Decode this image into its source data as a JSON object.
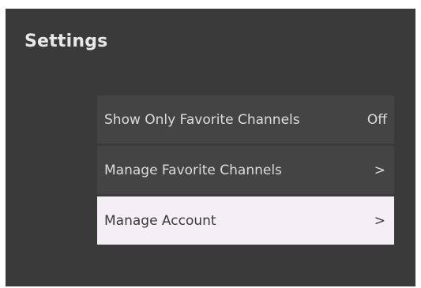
{
  "header": {
    "title": "Settings"
  },
  "menu": {
    "items": [
      {
        "label": "Show Only Favorite Channels",
        "value": "Off"
      },
      {
        "label": "Manage Favorite Channels",
        "chevron": ">"
      },
      {
        "label": "Manage Account",
        "chevron": ">",
        "selected": true
      }
    ]
  },
  "colors": {
    "background": "#3a3a3a",
    "item_background": "#444444",
    "selected_background": "#f6eef6",
    "text": "#dcdcdc",
    "selected_text": "#3a3a3a"
  }
}
